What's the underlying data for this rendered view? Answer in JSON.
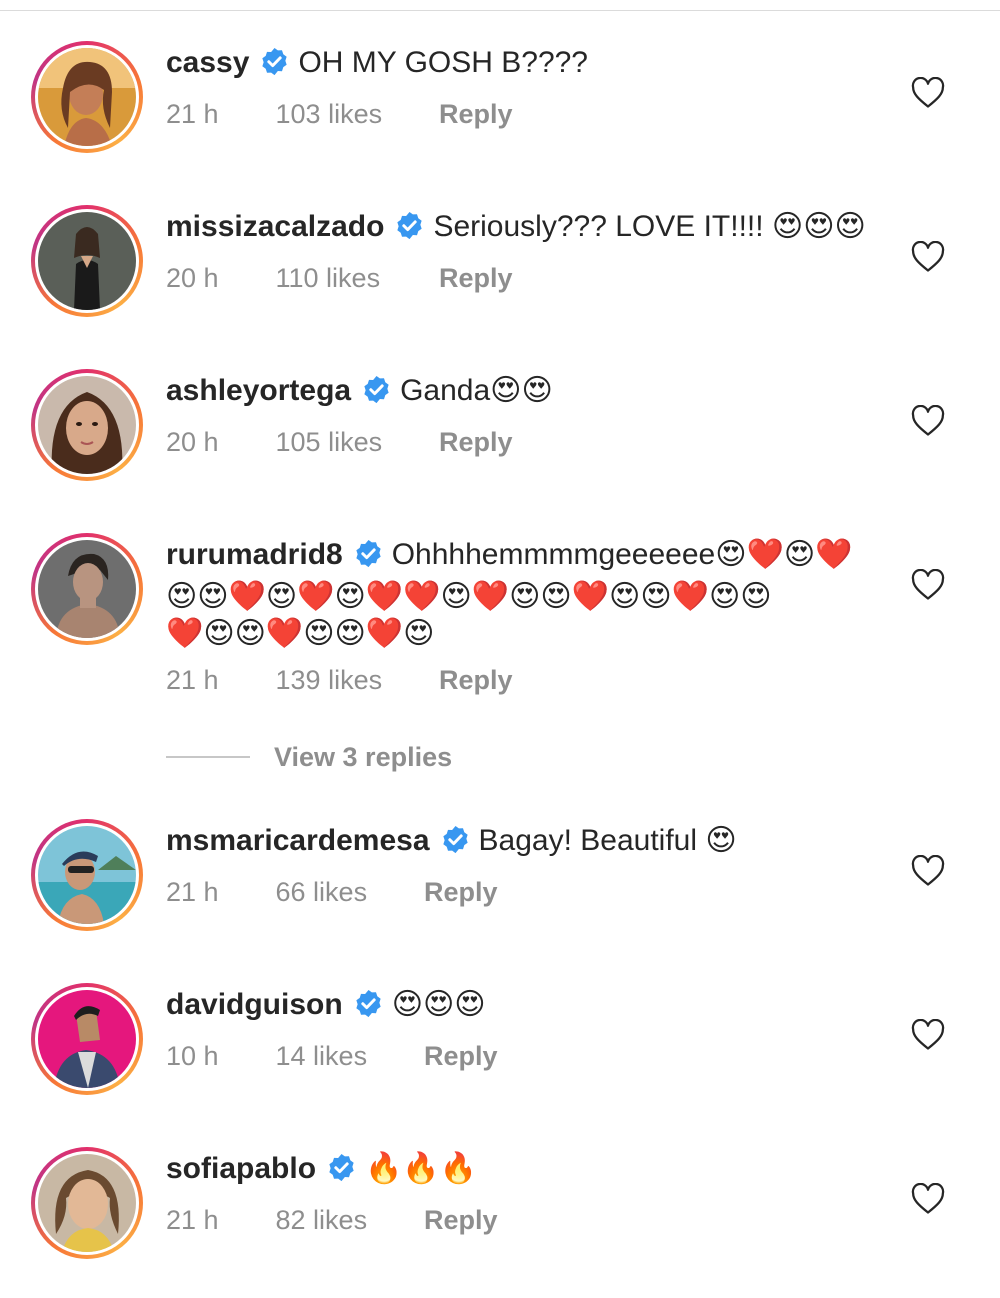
{
  "comments": [
    {
      "username": "cassy",
      "text": "OH MY GOSH B????",
      "time": "21 h",
      "likes": "103 likes",
      "reply": "Reply"
    },
    {
      "username": "missizacalzado",
      "text": "Seriously??? LOVE IT!!!! 😍😍😍",
      "time": "20 h",
      "likes": "110 likes",
      "reply": "Reply"
    },
    {
      "username": "ashleyortega",
      "text": "Ganda😍😍",
      "time": "20 h",
      "likes": "105 likes",
      "reply": "Reply"
    },
    {
      "username": "rurumadrid8",
      "text": "Ohhhhemmmmgeeeeee😍❤️😍❤️",
      "text_line2": "😍😍❤️😍❤️😍❤️❤️😍❤️😍😍❤️😍😍❤️😍😍",
      "text_line3": "❤️😍😍❤️😍😍❤️😍",
      "time": "21 h",
      "likes": "139 likes",
      "reply": "Reply"
    },
    {
      "username": "msmaricardemesa",
      "text": "Bagay! Beautiful 😍",
      "time": "21 h",
      "likes": "66 likes",
      "reply": "Reply"
    },
    {
      "username": "davidguison",
      "text": "😍😍😍",
      "time": "10 h",
      "likes": "14 likes",
      "reply": "Reply"
    },
    {
      "username": "sofiapablo",
      "text": "🔥🔥🔥",
      "time": "21 h",
      "likes": "82 likes",
      "reply": "Reply"
    }
  ],
  "view_replies": "View 3 replies",
  "icons": {
    "verified": "verified-badge-icon",
    "like": "heart-outline-icon"
  },
  "colors": {
    "verified": "#3897f0",
    "secondary_text": "#8e8e8e",
    "primary_text": "#262626"
  }
}
